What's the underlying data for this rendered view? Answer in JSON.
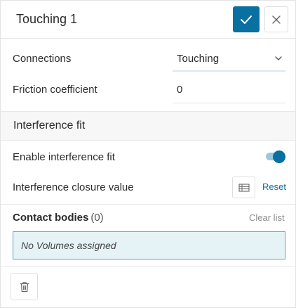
{
  "header": {
    "title": "Touching 1",
    "confirm_icon": "checkmark-icon",
    "close_icon": "close-icon"
  },
  "fields": {
    "connections": {
      "label": "Connections",
      "value": "Touching",
      "icon": "chevron-down-icon"
    },
    "friction": {
      "label": "Friction coefficient",
      "value": "0"
    }
  },
  "interference": {
    "section_title": "Interference fit",
    "enable_label": "Enable interference fit",
    "enable_state": true,
    "closure_label": "Interference closure value",
    "table_icon": "table-icon",
    "reset_label": "Reset"
  },
  "contact": {
    "title": "Contact bodies",
    "count": "(0)",
    "clear_label": "Clear list",
    "empty_text": "No Volumes assigned"
  },
  "footer": {
    "delete_icon": "trash-icon"
  },
  "colors": {
    "accent": "#0a6fa1",
    "accent_light": "#9cc7de",
    "assign_bg": "#e5f3f7",
    "assign_border": "#5aa5c0",
    "section_bg": "#f7f7f7"
  }
}
